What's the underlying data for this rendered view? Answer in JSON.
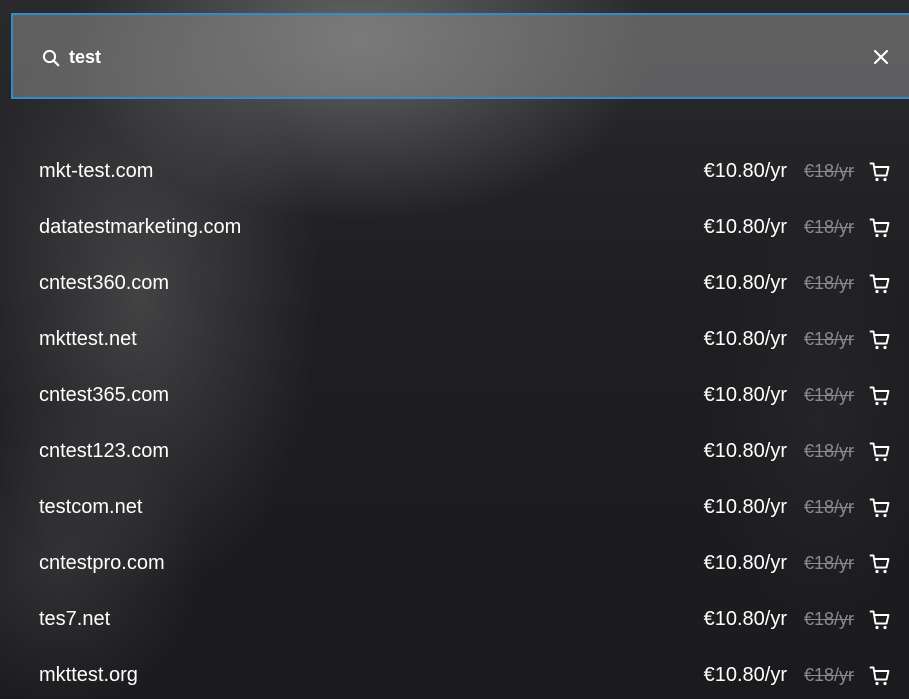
{
  "search": {
    "value": "test",
    "search_icon": "search-icon",
    "clear_icon": "close-icon"
  },
  "colors": {
    "accent_border": "#2f8ec4",
    "text": "#ffffff",
    "strike": "#8a8a8d"
  },
  "results": [
    {
      "domain": "mkt-test.com",
      "price": "€10.80/yr",
      "old_price": "€18/yr"
    },
    {
      "domain": "datatestmarketing.com",
      "price": "€10.80/yr",
      "old_price": "€18/yr"
    },
    {
      "domain": "cntest360.com",
      "price": "€10.80/yr",
      "old_price": "€18/yr"
    },
    {
      "domain": "mkttest.net",
      "price": "€10.80/yr",
      "old_price": "€18/yr"
    },
    {
      "domain": "cntest365.com",
      "price": "€10.80/yr",
      "old_price": "€18/yr"
    },
    {
      "domain": "cntest123.com",
      "price": "€10.80/yr",
      "old_price": "€18/yr"
    },
    {
      "domain": "testcom.net",
      "price": "€10.80/yr",
      "old_price": "€18/yr"
    },
    {
      "domain": "cntestpro.com",
      "price": "€10.80/yr",
      "old_price": "€18/yr"
    },
    {
      "domain": "tes7.net",
      "price": "€10.80/yr",
      "old_price": "€18/yr"
    },
    {
      "domain": "mkttest.org",
      "price": "€10.80/yr",
      "old_price": "€18/yr"
    }
  ],
  "row_icon": "cart-icon"
}
